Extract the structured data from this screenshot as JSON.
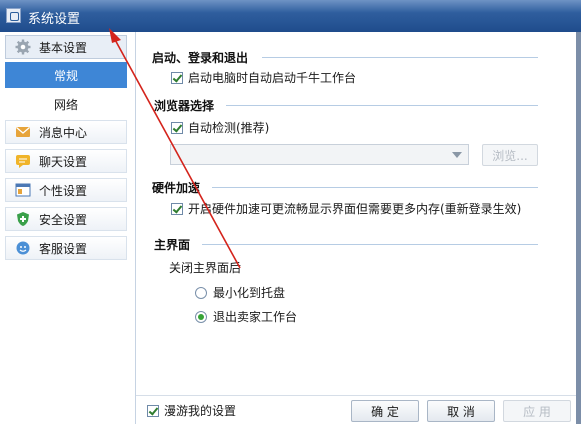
{
  "window": {
    "title": "系统设置"
  },
  "nav": {
    "basic": "基本设置",
    "sub_items": [
      "常规",
      "网络"
    ],
    "items": [
      {
        "label": "消息中心",
        "icon": "mail-icon"
      },
      {
        "label": "聊天设置",
        "icon": "chat-icon"
      },
      {
        "label": "个性设置",
        "icon": "window-icon"
      },
      {
        "label": "安全设置",
        "icon": "shield-icon"
      },
      {
        "label": "客服设置",
        "icon": "service-icon"
      }
    ]
  },
  "sections": {
    "startup": {
      "title": "启动、登录和退出",
      "auto_start": "启动电脑时自动启动千牛工作台"
    },
    "browser": {
      "title": "浏览器选择",
      "auto_detect": "自动检测(推荐)",
      "browse_button": "浏览..."
    },
    "hardware": {
      "title": "硬件加速",
      "enable": "开启硬件加速可更流畅显示界面但需要更多内存(重新登录生效)"
    },
    "main_ui": {
      "title": "主界面",
      "close_label": "关闭主界面后",
      "options": [
        "最小化到托盘",
        "退出卖家工作台"
      ],
      "selected": "退出卖家工作台"
    }
  },
  "footer": {
    "roam": "漫游我的设置",
    "ok": "确 定",
    "cancel": "取 消",
    "apply": "应 用"
  },
  "colors": {
    "accent": "#3e86d6",
    "annotation": "#d4241c"
  }
}
